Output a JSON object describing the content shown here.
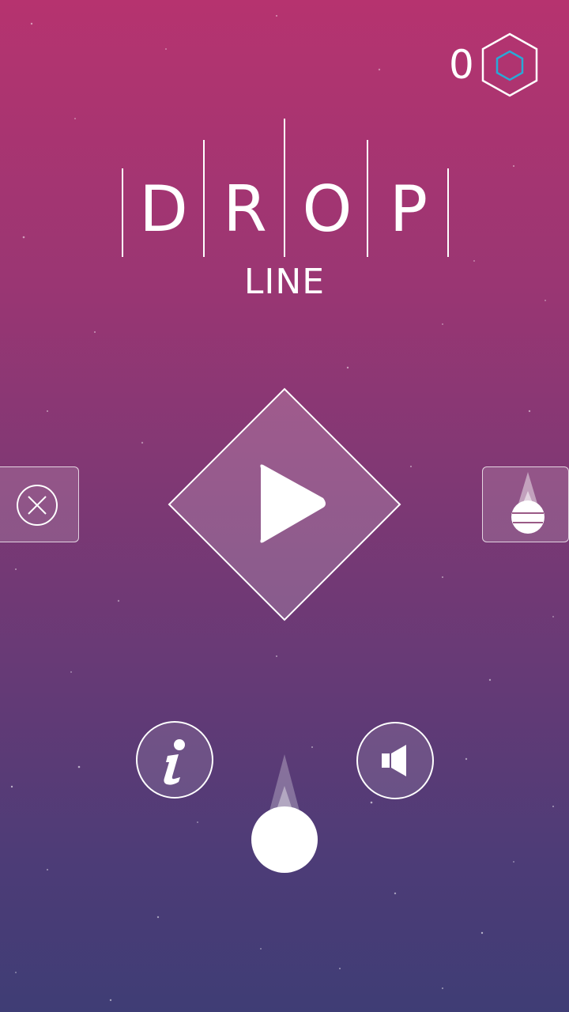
{
  "colors": {
    "background_top": "#b6336f",
    "background_bottom": "#3f3d75",
    "gem_accent": "#29a9d6",
    "foreground": "#ffffff"
  },
  "gem_counter": {
    "count": "0",
    "icon": "hexagon-gem-icon"
  },
  "title": {
    "letters": [
      "D",
      "R",
      "O",
      "P"
    ],
    "subtitle": "LINE"
  },
  "buttons": {
    "play": {
      "icon": "play-icon"
    },
    "close_tab": {
      "icon": "close-circle-icon"
    },
    "drop_skins_tab": {
      "icon": "drop-ball-icon"
    },
    "info": {
      "icon": "info-icon"
    },
    "sound": {
      "icon": "speaker-icon"
    }
  },
  "player": {
    "icon": "ball-with-trail"
  }
}
